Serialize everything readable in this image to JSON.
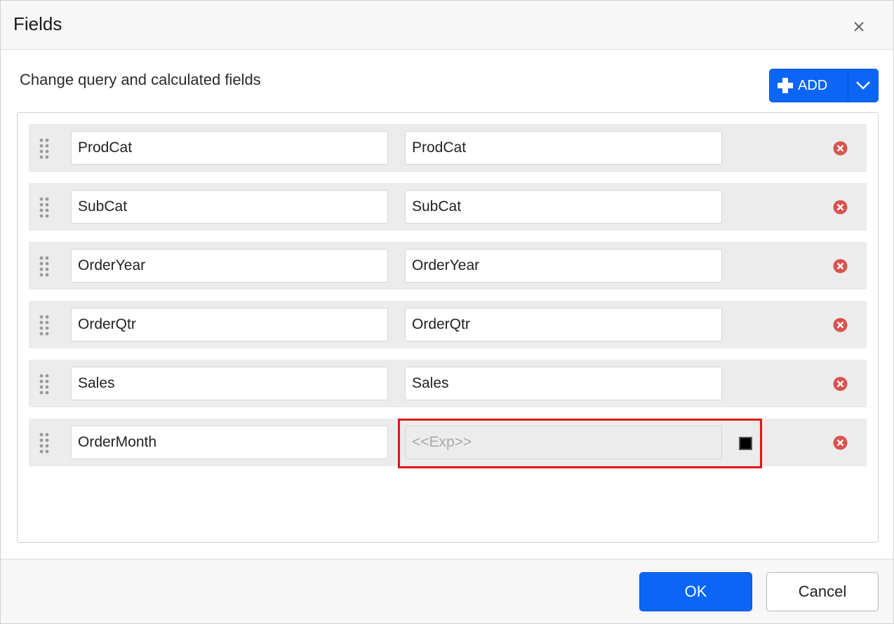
{
  "dialog": {
    "title": "Fields",
    "close_icon": "close-icon"
  },
  "section": {
    "title": "Change query and calculated fields"
  },
  "add_button": {
    "label": "ADD",
    "icon": "plus-icon",
    "dropdown_icon": "chevron-down-icon"
  },
  "fields": [
    {
      "name": "ProdCat",
      "expression": "ProdCat"
    },
    {
      "name": "SubCat",
      "expression": "SubCat"
    },
    {
      "name": "OrderYear",
      "expression": "OrderYear"
    },
    {
      "name": "OrderQtr",
      "expression": "OrderQtr"
    },
    {
      "name": "Sales",
      "expression": "Sales"
    },
    {
      "name": "OrderMonth",
      "expression": "",
      "expression_placeholder": "<<Exp>>"
    }
  ],
  "colors": {
    "accent": "#0b66f7",
    "remove_icon": "#d9534f",
    "highlight": "#e41515"
  },
  "footer": {
    "ok_label": "OK",
    "cancel_label": "Cancel"
  }
}
